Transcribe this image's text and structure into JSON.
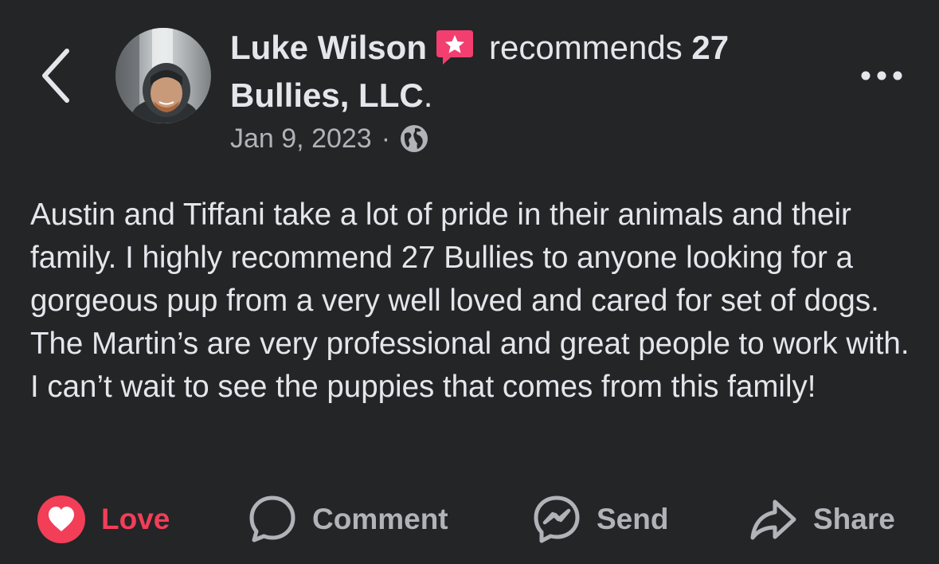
{
  "post": {
    "author": "Luke Wilson",
    "verb": "recommends",
    "page_name": "27 Bullies, LLC",
    "page_suffix": ".",
    "date": "Jan 9, 2023",
    "separator": "·",
    "body": "Austin and Tiffani take a lot of pride in their animals and their family. I highly recommend 27 Bullies to anyone looking for a gorgeous pup from a very well loved and cared for set of dogs. The Martin’s are very professional and great people to work with. I can’t wait to see the puppies that comes from this family!"
  },
  "icons": {
    "back": "chevron-left-icon",
    "badge": "recommendation-star-icon",
    "audience": "globe-icon",
    "more": "more-dots-icon",
    "love": "heart-icon",
    "comment": "comment-bubble-icon",
    "send": "messenger-icon",
    "share": "share-arrow-icon"
  },
  "actions": {
    "love": "Love",
    "comment": "Comment",
    "send": "Send",
    "share": "Share"
  },
  "colors": {
    "background": "#242527",
    "text": "#e4e6eb",
    "secondary_text": "#b0b3b8",
    "love": "#f33e58",
    "badge": "#f23f6f"
  }
}
